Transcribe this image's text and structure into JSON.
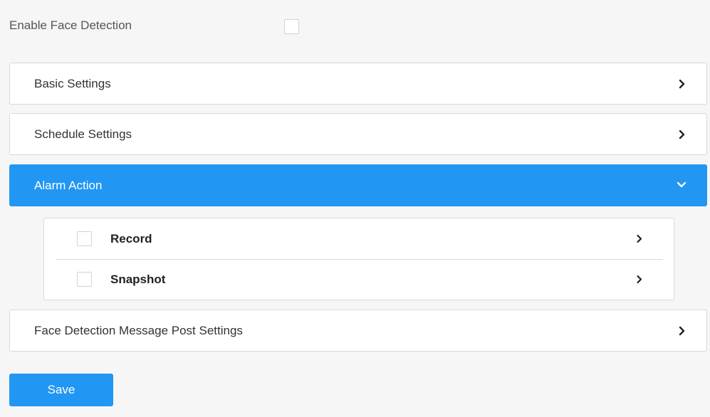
{
  "enable_face_detection": {
    "label": "Enable Face Detection",
    "checked": false
  },
  "panels": [
    {
      "title": "Basic Settings",
      "expanded": false,
      "icon": "chevron-right-icon"
    },
    {
      "title": "Schedule Settings",
      "expanded": false,
      "icon": "chevron-right-icon"
    },
    {
      "title": "Alarm Action",
      "expanded": true,
      "icon": "chevron-down-icon"
    },
    {
      "title": "Face Detection Message Post Settings",
      "expanded": false,
      "icon": "chevron-right-icon"
    }
  ],
  "alarm_action": {
    "items": [
      {
        "label": "Record",
        "checked": false,
        "icon": "chevron-right-icon"
      },
      {
        "label": "Snapshot",
        "checked": false,
        "icon": "chevron-right-icon"
      }
    ]
  },
  "save_label": "Save",
  "colors": {
    "accent": "#2196f3",
    "background": "#f6f6f6",
    "border": "#d9d9d9",
    "text": "#333333"
  }
}
